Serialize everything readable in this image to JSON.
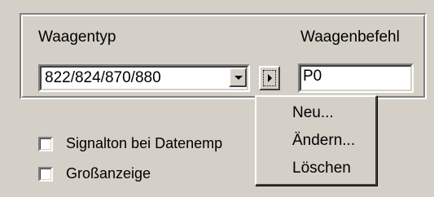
{
  "groupbox": {
    "scale_type_label": "Waagentyp",
    "scale_command_label": "Waagenbefehl",
    "scale_type_value": "822/824/870/880",
    "scale_command_value": "P0"
  },
  "options": {
    "beep_label": "Signalton bei Datenemp",
    "large_display_label": "Großanzeige",
    "beep_checked": false,
    "large_display_checked": false
  },
  "context_menu": {
    "items": [
      "Neu...",
      "Ändern...",
      "Löschen"
    ]
  }
}
